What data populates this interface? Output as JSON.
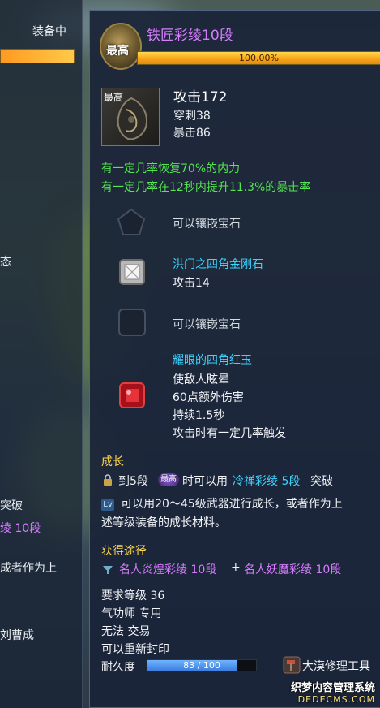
{
  "left_panel": {
    "title": "装备中",
    "text_1": "态",
    "text_2": "突破",
    "text_3": "绫 10段",
    "text_4": "成者作为上",
    "text_5": "刘曹成"
  },
  "tooltip": {
    "rank_badge": "最高",
    "item_name": "铁匠彩绫10段",
    "progress_text": "100.00%",
    "progress_value": 100,
    "icon_rank": "最高",
    "attack": "攻击172",
    "pierce": "穿刺38",
    "crit": "暴击86",
    "effect_1": "有一定几率恢复70%的内力",
    "effect_2": "有一定几率在12秒内提升11.3%的暴击率",
    "gems": [
      {
        "icon": "pentagon-slot-icon",
        "text": "可以镶嵌宝石"
      },
      {
        "icon": "diamond-gem-icon",
        "name": "洪门之四角金刚石",
        "effect": "攻击14"
      },
      {
        "icon": "square-slot-icon",
        "text": "可以镶嵌宝石"
      },
      {
        "icon": "ruby-gem-icon",
        "name": "耀眼的四角红玉",
        "effects": [
          "使敌人眩晕",
          "60点额外伤害",
          "持续1.5秒",
          "攻击时有一定几率触发"
        ]
      }
    ],
    "growth": {
      "header": "成长",
      "line1_prefix": "到5段",
      "line1_badge": "最高",
      "line1_mid": "时可以用",
      "line1_target": "冷禅彩绫 5段",
      "line1_suffix": "突破",
      "line2": "可以用20～45级武器进行成长，或者作为上",
      "line3": "述等级装备的成长材料。"
    },
    "obtain": {
      "header": "获得途径",
      "item_a": "名人炎煌彩绫 10段",
      "plus": "+",
      "item_b": "名人妖魔彩绫 10段"
    },
    "requirements": {
      "level": "要求等级 36",
      "class": "气功师 专用",
      "trade": "无法 交易",
      "reseal": "可以重新封印",
      "durability_label": "耐久度",
      "durability_text": "83 / 100",
      "durability_value": 83,
      "repair_tool": "大漠修理工具"
    }
  },
  "watermark": {
    "line1": "织梦内容管理系统",
    "line2": "DEDECMS.COM"
  },
  "colors": {
    "title_purple": "#d77bff",
    "effect_green": "#53e64f",
    "gem_cyan": "#3fd3ff",
    "section_yellow": "#ffd84c",
    "progress_orange": "#f7a21a",
    "durability_blue": "#3d7fe0"
  }
}
